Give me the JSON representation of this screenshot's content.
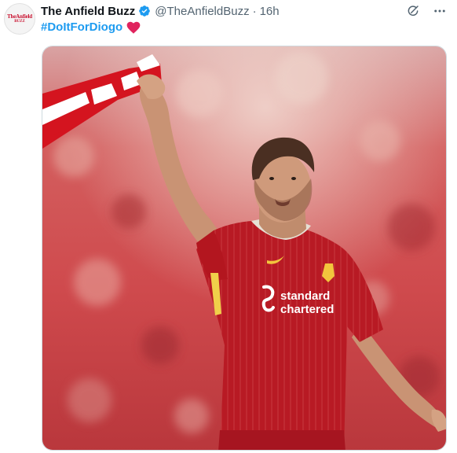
{
  "tweet": {
    "author": {
      "display_name": "The Anfield Buzz",
      "handle": "@TheAnfieldBuzz",
      "verified": true,
      "avatar_text_line1": "TheAnfield",
      "avatar_text_line2": "BUZZ"
    },
    "separator": "·",
    "timestamp": "16h",
    "hashtag": "#DoItForDiogo",
    "emoji": "red-heart",
    "actions": [
      "grok-icon",
      "more-options-icon"
    ]
  },
  "media": {
    "kit_sponsor_line1": "standard",
    "kit_sponsor_line2": "chartered"
  },
  "colors": {
    "accent_blue": "#1d9bf0",
    "text_primary": "#0f1419",
    "text_secondary": "#536471",
    "heart_red": "#e0245e",
    "kit_red": "#c8102e"
  }
}
